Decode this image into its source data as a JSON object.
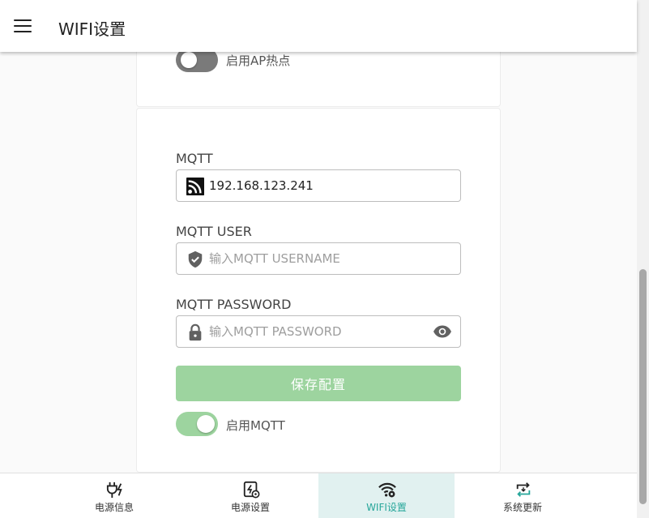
{
  "appbar": {
    "title": "WIFI设置"
  },
  "ap": {
    "switch_label": "启用AP热点",
    "enabled": false
  },
  "mqtt": {
    "server_label": "MQTT",
    "server_value": "192.168.123.241",
    "user_label": "MQTT USER",
    "user_placeholder": "输入MQTT USERNAME",
    "password_label": "MQTT PASSWORD",
    "password_placeholder": "输入MQTT PASSWORD",
    "save_label": "保存配置",
    "switch_label": "启用MQTT",
    "enabled": true
  },
  "nav": {
    "items": [
      {
        "label": "电源信息",
        "icon": "power-plug-icon"
      },
      {
        "label": "电源设置",
        "icon": "power-settings-icon"
      },
      {
        "label": "WIFI设置",
        "icon": "wifi-settings-icon",
        "active": true
      },
      {
        "label": "系统更新",
        "icon": "update-icon"
      }
    ]
  },
  "colors": {
    "accent": "#26a69a",
    "switch_on": "#9dd49f",
    "switch_off": "#7a7a7a"
  }
}
